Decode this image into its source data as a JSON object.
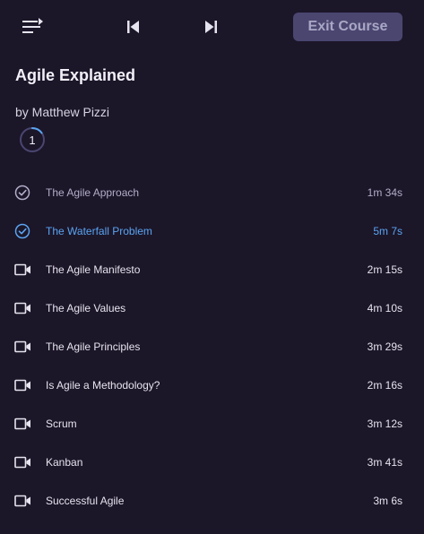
{
  "header": {
    "menu_icon": "list-menu-icon",
    "prev_icon": "skip-previous-icon",
    "next_icon": "skip-next-icon",
    "exit_label": "Exit Course"
  },
  "course": {
    "title": "Agile Explained",
    "author": "by Matthew Pizzi",
    "module_number": "1",
    "module_progress": 0.15
  },
  "colors": {
    "background": "#1c1629",
    "exit_button_bg": "#4a4670",
    "active": "#5aa4f0",
    "watched": "#b2aec7",
    "text": "#e6e4ee"
  },
  "clips": [
    {
      "title": "The Agile Approach",
      "duration": "1m 34s",
      "state": "watched",
      "icon": "check-circle-icon"
    },
    {
      "title": "The Waterfall Problem",
      "duration": "5m 7s",
      "state": "active",
      "icon": "check-circle-icon"
    },
    {
      "title": "The Agile Manifesto",
      "duration": "2m 15s",
      "state": "unwatched",
      "icon": "video-camera-icon"
    },
    {
      "title": "The Agile Values",
      "duration": "4m 10s",
      "state": "unwatched",
      "icon": "video-camera-icon"
    },
    {
      "title": "The Agile Principles",
      "duration": "3m 29s",
      "state": "unwatched",
      "icon": "video-camera-icon"
    },
    {
      "title": "Is Agile a Methodology?",
      "duration": "2m 16s",
      "state": "unwatched",
      "icon": "video-camera-icon"
    },
    {
      "title": "Scrum",
      "duration": "3m 12s",
      "state": "unwatched",
      "icon": "video-camera-icon"
    },
    {
      "title": "Kanban",
      "duration": "3m 41s",
      "state": "unwatched",
      "icon": "video-camera-icon"
    },
    {
      "title": "Successful Agile",
      "duration": "3m 6s",
      "state": "unwatched",
      "icon": "video-camera-icon"
    }
  ]
}
